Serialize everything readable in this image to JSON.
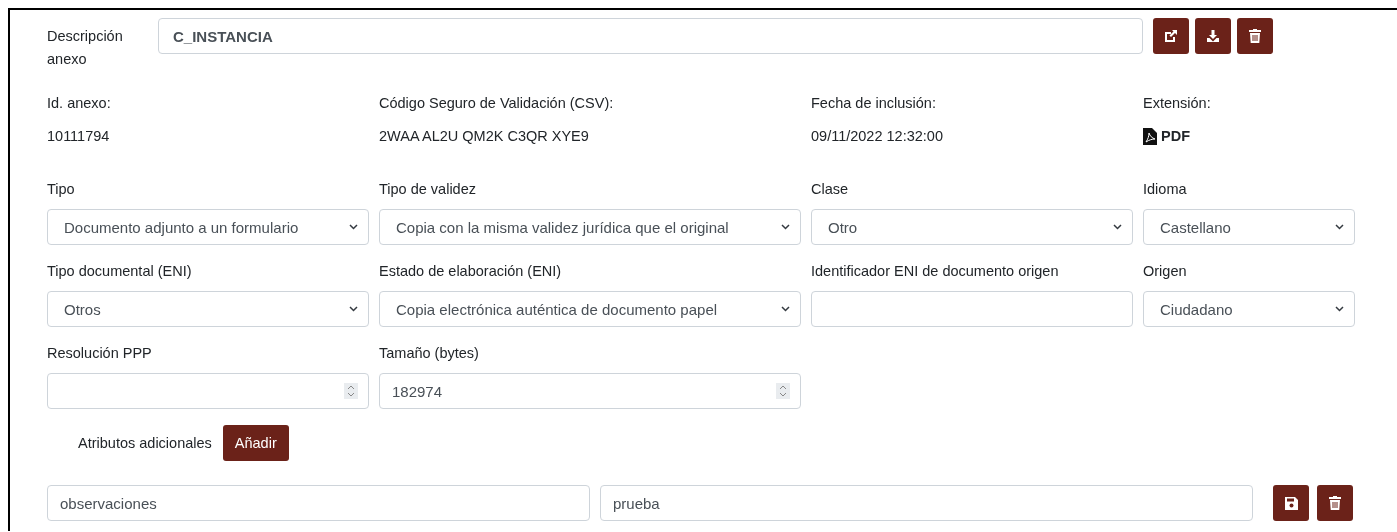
{
  "description": {
    "label": "Descripción anexo",
    "value": "C_INSTANCIA"
  },
  "actions": [
    {
      "kind": "open"
    },
    {
      "kind": "download"
    },
    {
      "kind": "delete"
    }
  ],
  "info": [
    {
      "label": "Id. anexo:",
      "value": "10111794"
    },
    {
      "label": "Código Seguro de Validación (CSV):",
      "value": "2WAA AL2U QM2K C3QR XYE9"
    },
    {
      "label": "Fecha de inclusión:",
      "value": "09/11/2022 12:32:00"
    },
    {
      "label": "Extensión:",
      "value": "PDF",
      "kind": "file"
    }
  ],
  "fields": [
    {
      "label": "Tipo",
      "kind": "select",
      "value": "Documento adjunto a un formulario"
    },
    {
      "label": "Tipo de validez",
      "kind": "select",
      "value": "Copia con la misma validez jurídica que el original"
    },
    {
      "label": "Clase",
      "kind": "select",
      "value": "Otro"
    },
    {
      "label": "Idioma",
      "kind": "select",
      "value": "Castellano"
    },
    {
      "label": "Tipo documental (ENI)",
      "kind": "select",
      "value": "Otros"
    },
    {
      "label": "Estado de elaboración (ENI)",
      "kind": "select",
      "value": "Copia electrónica auténtica de documento papel"
    },
    {
      "label": "Identificador ENI de documento origen",
      "kind": "text"
    },
    {
      "label": "Origen",
      "kind": "select",
      "value": "Ciudadano"
    },
    {
      "label": "Resolución PPP",
      "kind": "number"
    },
    {
      "label": "Tamaño (bytes)",
      "kind": "number",
      "value": "182974"
    }
  ],
  "extra_attributes": {
    "label": "Atributos adicionales",
    "button": "Añadir",
    "rows": [
      {
        "name": "observaciones",
        "value": "prueba",
        "actions": [
          {
            "kind": "save"
          },
          {
            "kind": "delete"
          }
        ]
      }
    ]
  }
}
